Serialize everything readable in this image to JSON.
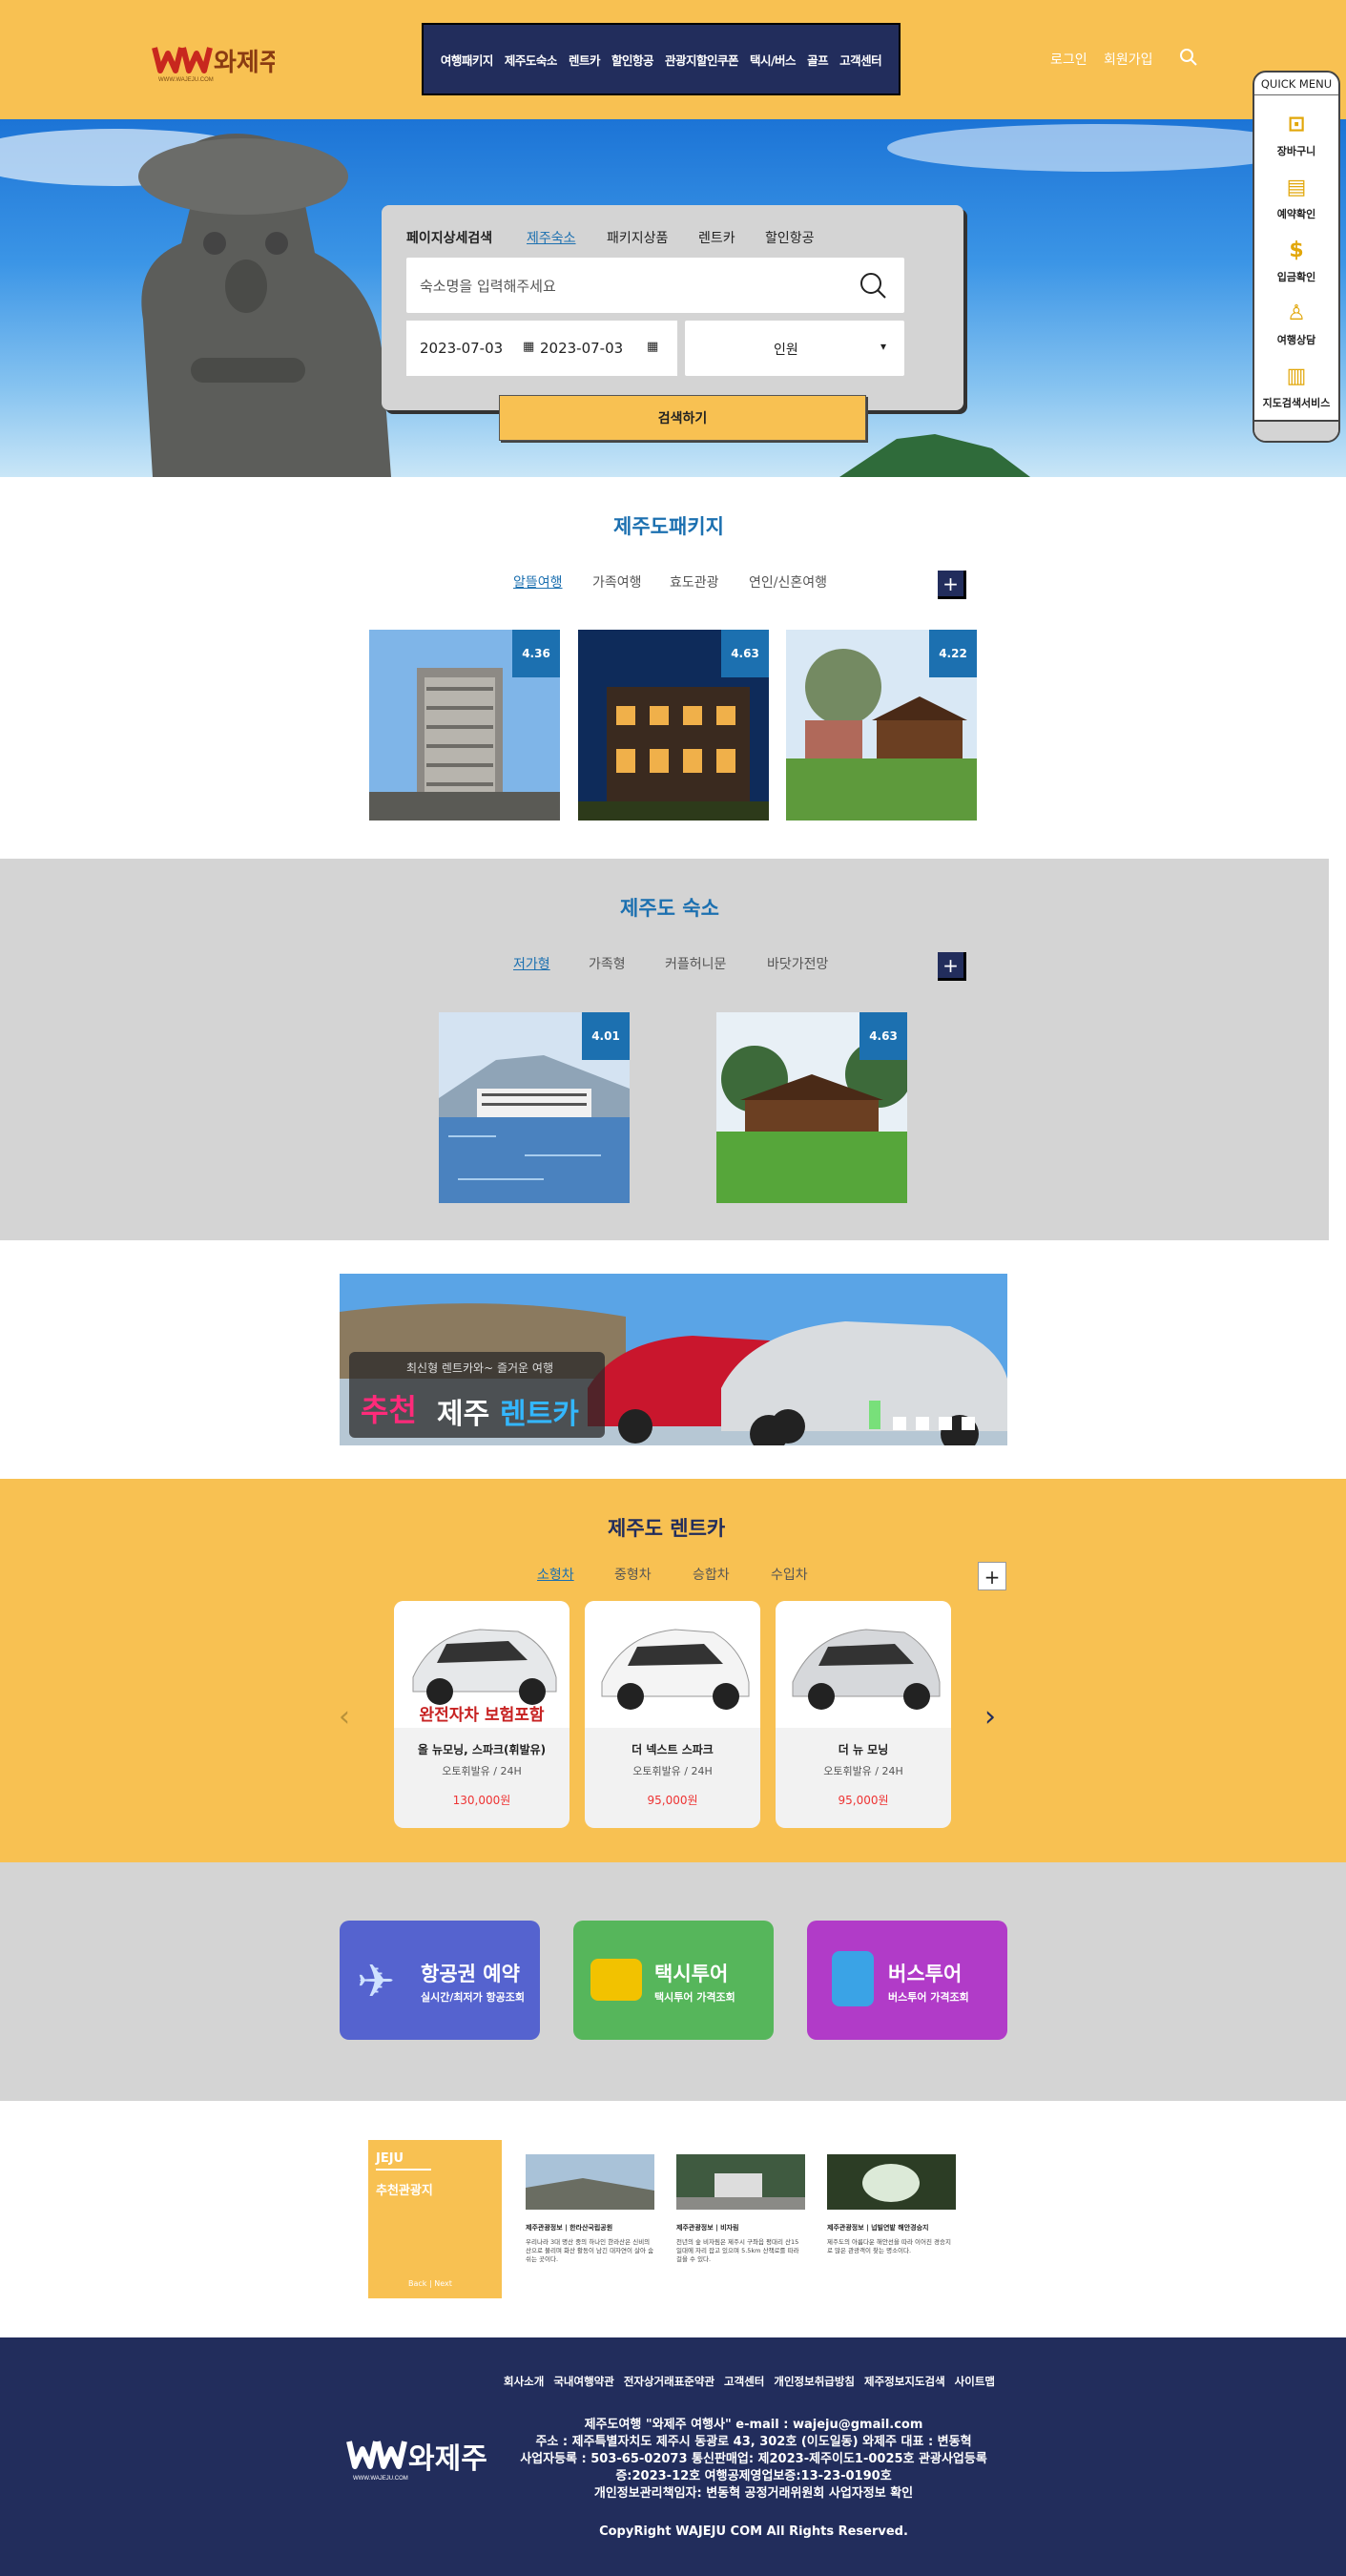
{
  "header": {
    "logo_text": "와제주",
    "logo_sub": "WWW.WAJEJU.COM",
    "nav": [
      "여행패키지",
      "제주도숙소",
      "렌트카",
      "할인항공",
      "관광지할인쿠폰",
      "택시/버스",
      "골프",
      "고객센터"
    ],
    "login": "로그인",
    "signup": "회원가입"
  },
  "search": {
    "title": "페이지상세검색",
    "tabs": [
      "제주숙소",
      "패키지상품",
      "렌트카",
      "할인항공"
    ],
    "placeholder": "숙소명을 입력해주세요",
    "date_from": "2023-07-03",
    "date_to": "2023-07-03",
    "people": "인원",
    "button": "검색하기"
  },
  "quick_menu": {
    "title": "QUICK MENU",
    "items": [
      "장바구니",
      "예약확인",
      "입금확인",
      "여행상담",
      "지도검색서비스"
    ]
  },
  "package": {
    "title": "제주도패키지",
    "tabs": [
      "알뜰여행",
      "가족여행",
      "효도관광",
      "연인/신혼여행"
    ],
    "plus": "+",
    "ratings": [
      "4.36",
      "4.63",
      "4.22"
    ]
  },
  "lodging": {
    "title": "제주도 숙소",
    "tabs": [
      "저가형",
      "가족형",
      "커플허니문",
      "바닷가전망"
    ],
    "plus": "+",
    "ratings": [
      "4.01",
      "4.63"
    ]
  },
  "banner": {
    "small": "최신형 렌트카와~ 즐거운 여행",
    "big1": "추천",
    "big2": "제주",
    "big3": "렌트카"
  },
  "rental": {
    "title": "제주도 렌트카",
    "tabs": [
      "소형차",
      "중형차",
      "승합차",
      "수입차"
    ],
    "plus": "+",
    "cars": [
      {
        "name": "올 뉴모닝, 스파크(휘발유)",
        "sub": "오토휘발유 / 24H",
        "price": "130,000원",
        "badge": "완전자차 보험포함"
      },
      {
        "name": "더 넥스트 스파크",
        "sub": "오토휘발유 / 24H",
        "price": "95,000원"
      },
      {
        "name": "더 뉴 모닝",
        "sub": "오토휘발유 / 24H",
        "price": "95,000원"
      }
    ]
  },
  "services": [
    {
      "title": "항공권 예약",
      "sub": "실시간/최저가 항공조회",
      "color": "#5563cf"
    },
    {
      "title": "택시투어",
      "sub": "택시투어 가격조회",
      "color": "#56b65b"
    },
    {
      "title": "버스투어",
      "sub": "버스투어 가격조회",
      "color": "#b13bc8"
    }
  ],
  "tourist": {
    "label1": "JEJU",
    "label2": "추천관광지",
    "nav": "Back | Next",
    "items": [
      {
        "cap": "제주관광정보 | 한라산국립공원",
        "desc": "우리나라 3대 명산 중의 하나인 한라산은 신비의 산으로 불리며 화산 활동이 남긴 대자연이 살아 숨쉬는 곳이다."
      },
      {
        "cap": "제주관광정보 | 비자림",
        "desc": "천년의 숲 비자림은 제주시 구좌읍 평대리 산15 일대에 자리 잡고 있으며 5.5km 산책로를 따라 걸을 수 있다."
      },
      {
        "cap": "제주관광정보 | 넙빌연밭 해안경승지",
        "desc": "제주도의 아름다운 해안선을 따라 이어진 경승지로 많은 관광객이 찾는 명소이다."
      }
    ]
  },
  "footer": {
    "links": [
      "회사소개",
      "국내여행약관",
      "전자상거래표준약관",
      "고객센터",
      "개인정보취급방침",
      "제주정보지도검색",
      "사이트맵"
    ],
    "info": [
      "제주도여행 \"와제주 여행사\" e-mail : wajeju@gmail.com",
      "주소 : 제주특별자치도 제주시 동광로 43, 302호 (이도일동) 와제주 대표 : 변동혁",
      "사업자등록 : 503-65-02073 통신판매업: 제2023-제주이도1-0025호 관광사업등록",
      "증:2023-12호 여행공제영업보증:13-23-0190호",
      "개인정보관리책임자: 변동혁 공정거래위원회 사업자정보 확인"
    ],
    "copyright": "CopyRight WAJEJU COM All Rights Reserved."
  }
}
